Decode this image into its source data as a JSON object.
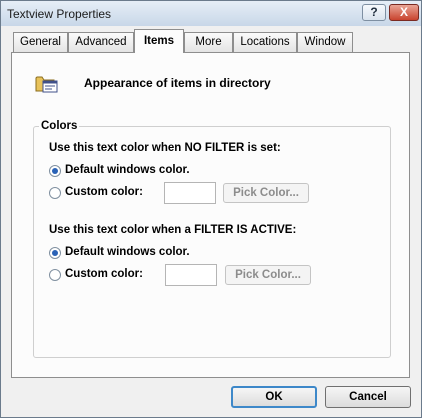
{
  "window": {
    "title": "Textview Properties",
    "help_label": "?",
    "close_label": "X"
  },
  "tabs": [
    {
      "label": "General"
    },
    {
      "label": "Advanced"
    },
    {
      "label": "Items",
      "active": true
    },
    {
      "label": "More"
    },
    {
      "label": "Locations"
    },
    {
      "label": "Window"
    }
  ],
  "header": {
    "icon": "folder-icon",
    "text": "Appearance of items in directory"
  },
  "colors_group": {
    "title": "Colors",
    "no_filter": {
      "prompt": "Use this text color when NO FILTER is set:",
      "default_option": "Default windows color.",
      "custom_option": "Custom color:",
      "pick_label": "Pick Color...",
      "selected": "default"
    },
    "filter_active": {
      "prompt": "Use this text color when a FILTER IS ACTIVE:",
      "default_option": "Default windows color.",
      "custom_option": "Custom color:",
      "pick_label": "Pick Color...",
      "selected": "default"
    }
  },
  "buttons": {
    "ok": "OK",
    "cancel": "Cancel"
  },
  "colors": {
    "radio_checked": "#2a62b6",
    "default_button_border": "#3d88c9",
    "close_button": "#c9432e"
  }
}
